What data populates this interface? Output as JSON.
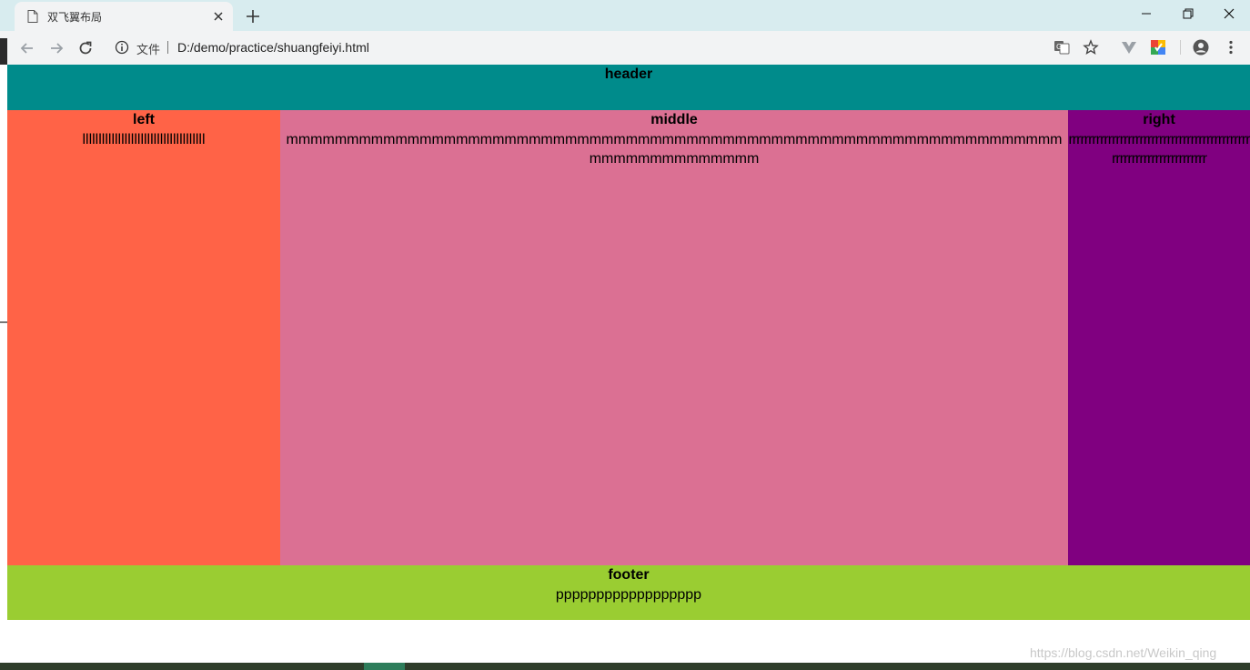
{
  "browser": {
    "tab_title": "双飞翼布局",
    "scheme_label": "文件",
    "url": "D:/demo/practice/shuangfeiyi.html"
  },
  "page": {
    "header": {
      "title": "header"
    },
    "left": {
      "title": "left",
      "text": "llllllllllllllllllllllllllllllllllllll"
    },
    "middle": {
      "title": "middle",
      "text": "mmmmmmmmmmmmmmmmmmmmmmmmmmmmmmmmmmmmmmmmmmmmmmmmmmmmmmmmmmmmmmmmmmmmmmmmmmmmmm"
    },
    "right": {
      "title": "right",
      "text": "rrrrrrrrrrrrrrrrrrrrrrrrrrrrrrrrrrrrrrrrrrrrrrrrrrrrrrrrrrrrrrrrrrrrrr"
    },
    "footer": {
      "title": "footer",
      "text": "pppppppppppppppppp"
    }
  },
  "colors": {
    "header": "#008b8b",
    "left": "#ff6347",
    "middle": "#db7093",
    "right": "#800080",
    "footer": "#9acd32"
  },
  "watermark": "https://blog.csdn.net/Weikin_qing"
}
